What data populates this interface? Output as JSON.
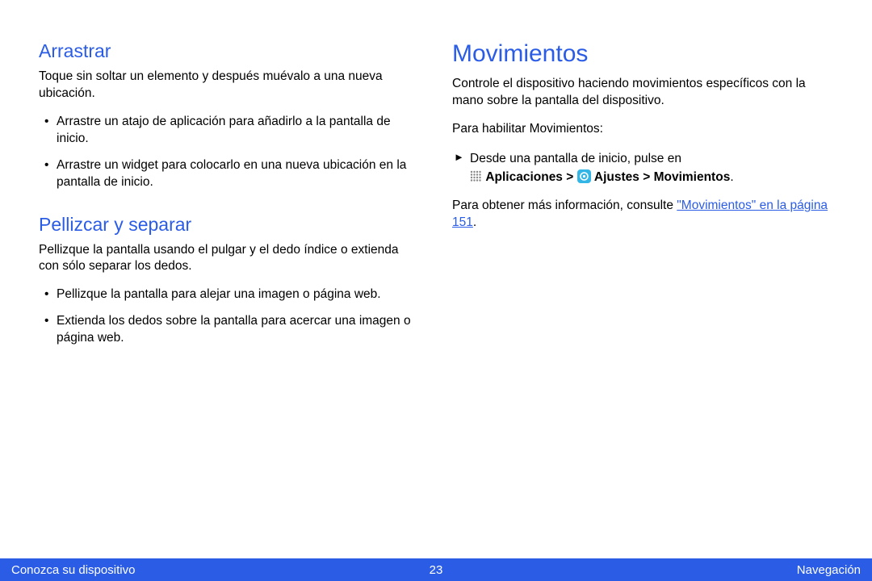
{
  "left": {
    "h_drag": "Arrastrar",
    "drag_intro": "Toque sin soltar un elemento y después muévalo a una nueva ubicación.",
    "drag_items": [
      "Arrastre un atajo de aplicación para añadirlo a la pantalla de inicio.",
      "Arrastre un widget para colocarlo en una nueva ubicación en la pantalla de inicio."
    ],
    "h_pinch": "Pellizcar y separar",
    "pinch_intro": "Pellizque la pantalla usando el pulgar y el dedo índice o extienda con sólo separar los dedos.",
    "pinch_items": [
      "Pellizque la pantalla para alejar una imagen o página web.",
      "Extienda los dedos sobre la pantalla para acercar una imagen o página web."
    ]
  },
  "right": {
    "h_motion": "Movimientos",
    "motion_intro": "Controle el dispositivo haciendo movimientos específicos con la mano sobre la pantalla del dispositivo.",
    "enable_label": "Para habilitar Movimientos:",
    "step_prefix": "Desde una pantalla de inicio, pulse en",
    "apps_label": "Aplicaciones >",
    "settings_label": "Ajustes > Movimientos",
    "more_info_prefix": "Para obtener más información, consulte ",
    "link_text": "\"Movimientos\" en la página 151"
  },
  "footer": {
    "left": "Conozca su dispositivo",
    "center": "23",
    "right": "Navegación"
  }
}
